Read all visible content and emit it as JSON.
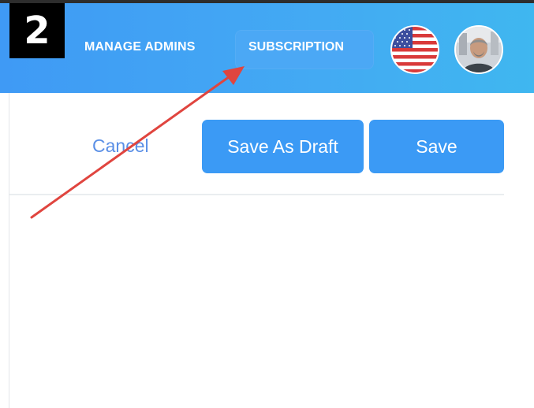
{
  "step_badge": "2",
  "header": {
    "nav": {
      "manage_admins": "MANAGE ADMINS",
      "subscription": "SUBSCRIPTION"
    },
    "flag_icon": "us-flag-icon",
    "avatar_icon": "user-avatar-icon"
  },
  "toolbar": {
    "cancel_label": "Cancel",
    "save_draft_label": "Save As Draft",
    "save_label": "Save"
  },
  "colors": {
    "header_blue": "#43aaf3",
    "button_blue": "#3b9af5",
    "link_blue": "#5a8fe6",
    "annotation_red": "#e0453f"
  }
}
